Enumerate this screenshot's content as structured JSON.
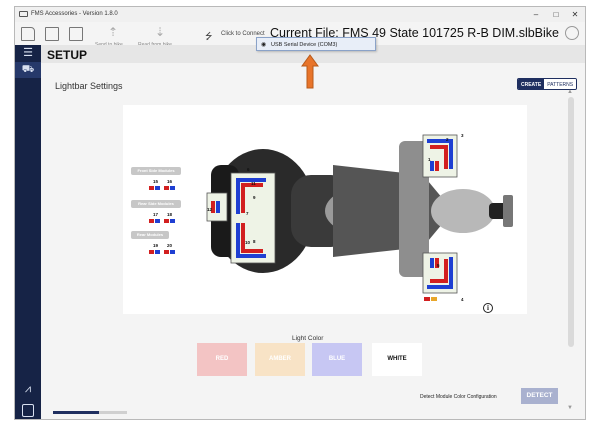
{
  "window": {
    "title": "FMS Accessories - Version 1.8.0",
    "minimize": "–",
    "maximize": "□",
    "close": "✕"
  },
  "toolbar": {
    "send_label": "Send to bike",
    "read_label": "Read from bike",
    "connect_label": "Click to Connect",
    "current_file": "Current File: FMS 49 State 101725 R-B DIM.slbBike"
  },
  "port_dropdown": {
    "item": "USB Serial Device (COM3)"
  },
  "page": {
    "title": "SETUP",
    "section_title": "Lightbar Settings"
  },
  "mode_toggle": {
    "create": "CREATE",
    "patterns": "PATTERNS",
    "selected": "CREATE"
  },
  "module_groups": [
    {
      "label": "Front Side Modules",
      "modules": [
        "15",
        "16"
      ]
    },
    {
      "label": "Rear Side Modules",
      "modules": [
        "17",
        "18"
      ]
    },
    {
      "label": "Rear Modules",
      "modules": [
        "19",
        "20"
      ]
    }
  ],
  "bike_modules": [
    "1",
    "2",
    "3",
    "4",
    "5",
    "6",
    "7",
    "8",
    "9",
    "10",
    "11",
    "12"
  ],
  "light_color": {
    "label": "Light Color",
    "options": [
      {
        "label": "RED",
        "bg": "#f3c4c4"
      },
      {
        "label": "AMBER",
        "bg": "#f8e3c6"
      },
      {
        "label": "BLUE",
        "bg": "#c7c7f3"
      },
      {
        "label": "WHITE",
        "bg": "#ffffff"
      }
    ],
    "selected": "WHITE"
  },
  "detect": {
    "label": "Detect Module Color Configuration",
    "button": "DETECT"
  },
  "progress": {
    "value": 0.62
  },
  "colors": {
    "nav": "#162346",
    "accent": "#1f2f60",
    "red": "#d21f1f",
    "blue": "#1f3fd2",
    "arrow": "#e8742a"
  }
}
